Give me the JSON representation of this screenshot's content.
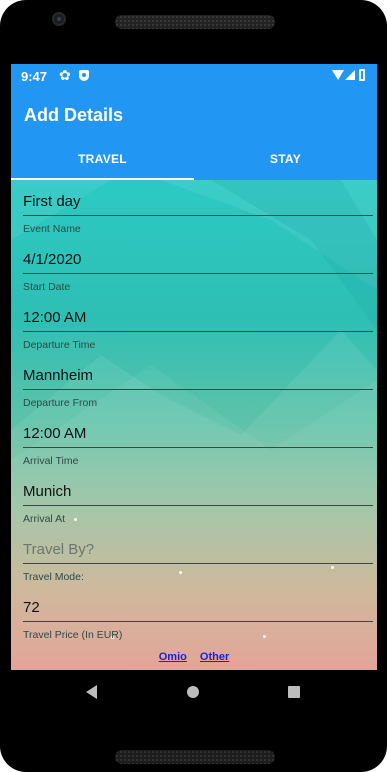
{
  "status_bar": {
    "time": "9:47",
    "icons": [
      "gear-icon",
      "shield-icon",
      "wifi-icon",
      "signal-icon",
      "battery-icon"
    ]
  },
  "app_bar": {
    "title": "Add Details"
  },
  "tabs": [
    {
      "label": "TRAVEL",
      "selected": true
    },
    {
      "label": "STAY",
      "selected": false
    }
  ],
  "form": {
    "event_name": {
      "value": "First day",
      "label": "Event Name"
    },
    "start_date": {
      "value": "4/1/2020",
      "label": "Start Date"
    },
    "departure_time": {
      "value": "12:00 AM",
      "label": "Departure Time"
    },
    "departure_from": {
      "value": "Mannheim",
      "label": "Departure From"
    },
    "arrival_time": {
      "value": "12:00 AM",
      "label": "Arrival Time"
    },
    "arrival_at": {
      "value": "Munich",
      "label": "Arrival At"
    },
    "travel_mode": {
      "value": "",
      "placeholder": "Travel By?",
      "label": "Travel Mode:"
    },
    "travel_price": {
      "value": "72",
      "label": "Travel Price (In EUR)"
    }
  },
  "links": {
    "omio": "Omio",
    "other": "Other"
  },
  "nav_bar": {
    "icons": [
      "back-icon",
      "home-icon",
      "recent-apps-icon"
    ]
  },
  "colors": {
    "primary": "#2196f3",
    "link": "#1a23d8",
    "gradient_top": "#2cc9c4",
    "gradient_bottom": "#e0988a"
  }
}
